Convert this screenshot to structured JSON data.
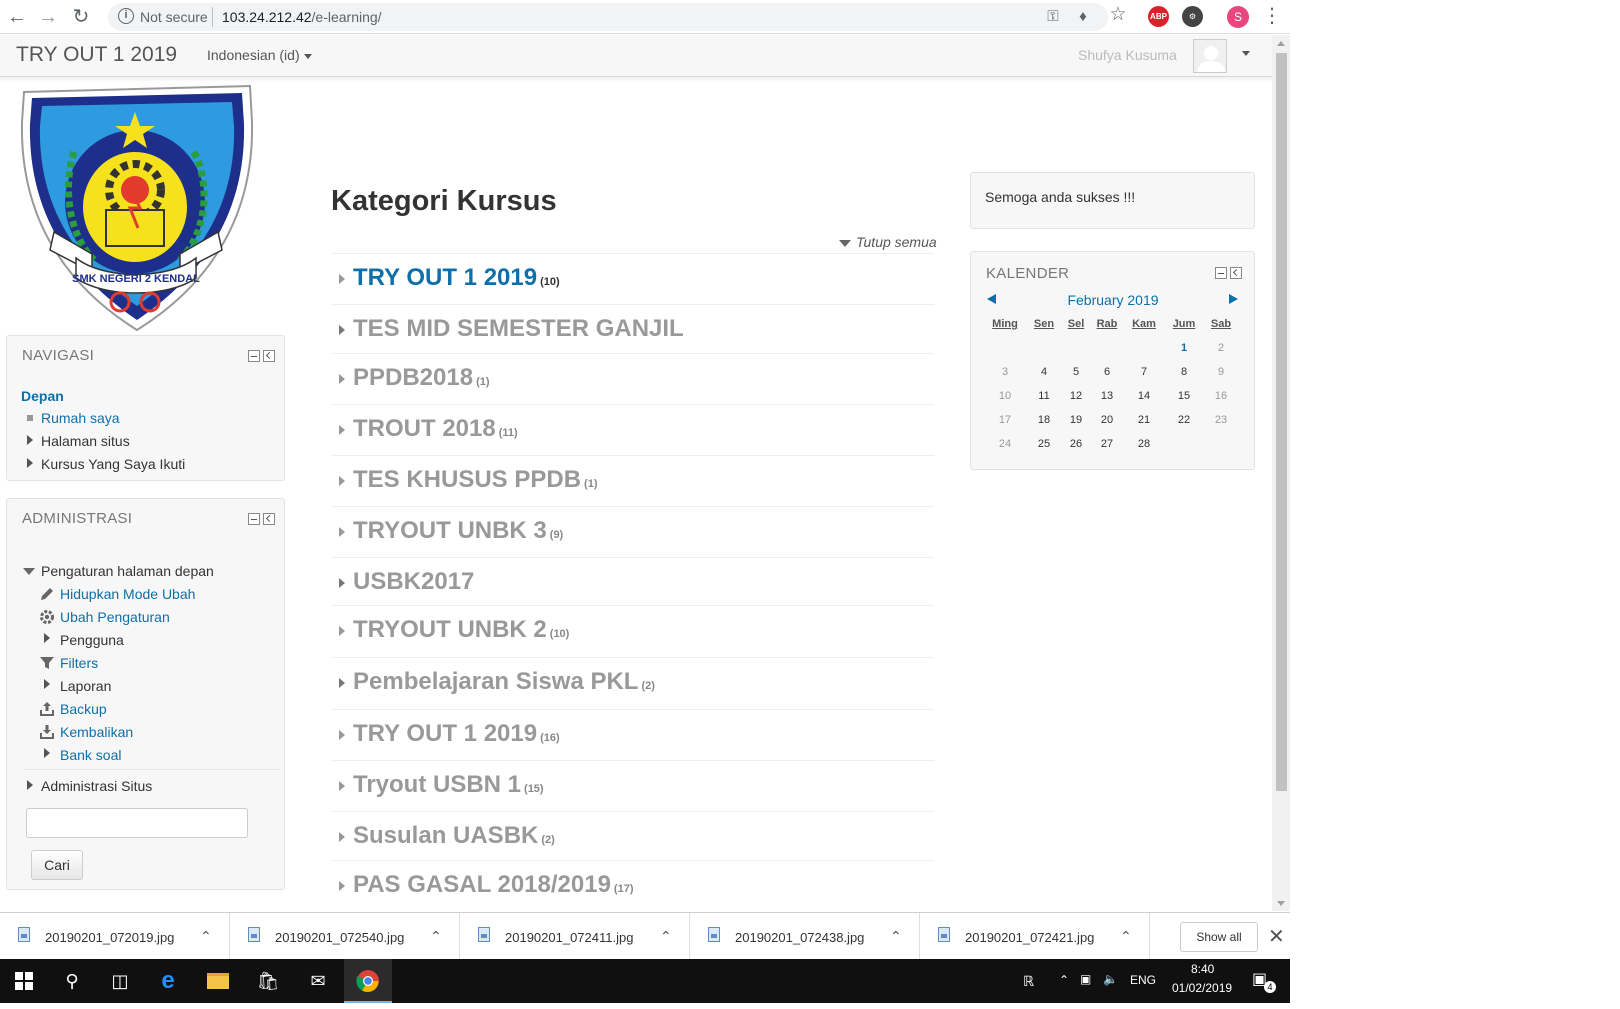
{
  "browser": {
    "security_label": "Not secure",
    "url_host": "103.24.212.42",
    "url_path": "/e-learning/",
    "profile_initial": "S",
    "ext_abp": "ABP"
  },
  "navbar": {
    "brand": "TRY OUT 1 2019",
    "language": "Indonesian (id)",
    "username": "Shufya Kusuma"
  },
  "logo": {
    "banner_text": "SMK NEGERI 2 KENDAL"
  },
  "navigasi": {
    "title": "NAVIGASI",
    "home": "Depan",
    "items": [
      "Rumah saya",
      "Halaman situs",
      "Kursus Yang Saya Ikuti"
    ]
  },
  "administrasi": {
    "title": "ADMINISTRASI",
    "section": "Pengaturan halaman depan",
    "items": [
      "Hidupkan Mode Ubah",
      "Ubah Pengaturan",
      "Pengguna",
      "Filters",
      "Laporan",
      "Backup",
      "Kembalikan",
      "Bank soal"
    ],
    "site_admin": "Administrasi Situs",
    "search_button": "Cari"
  },
  "main": {
    "title": "Kategori Kursus",
    "collapse_all": "Tutup semua",
    "categories": [
      {
        "name": "TRY OUT 1 2019",
        "count": "(10)"
      },
      {
        "name": "TES MID SEMESTER GANJIL",
        "count": ""
      },
      {
        "name": "PPDB2018",
        "count": "(1)"
      },
      {
        "name": "TROUT 2018",
        "count": "(11)"
      },
      {
        "name": "TES KHUSUS PPDB",
        "count": "(1)"
      },
      {
        "name": "TRYOUT UNBK 3",
        "count": "(9)"
      },
      {
        "name": "USBK2017",
        "count": ""
      },
      {
        "name": "TRYOUT UNBK 2",
        "count": "(10)"
      },
      {
        "name": "Pembelajaran Siswa PKL",
        "count": "(2)"
      },
      {
        "name": "TRY OUT 1 2019",
        "count": "(16)"
      },
      {
        "name": "Tryout USBN 1",
        "count": "(15)"
      },
      {
        "name": "Susulan UASBK",
        "count": "(2)"
      },
      {
        "name": "PAS GASAL 2018/2019",
        "count": "(17)"
      }
    ]
  },
  "message_block": {
    "text": "Semoga anda sukses !!!"
  },
  "calendar": {
    "title": "KALENDER",
    "month": "February 2019",
    "days": [
      "Ming",
      "Sen",
      "Sel",
      "Rab",
      "Kam",
      "Jum",
      "Sab"
    ],
    "weeks": [
      [
        "",
        "",
        "",
        "",
        "",
        "1",
        "2"
      ],
      [
        "3",
        "4",
        "5",
        "6",
        "7",
        "8",
        "9"
      ],
      [
        "10",
        "11",
        "12",
        "13",
        "14",
        "15",
        "16"
      ],
      [
        "17",
        "18",
        "19",
        "20",
        "21",
        "22",
        "23"
      ],
      [
        "24",
        "25",
        "26",
        "27",
        "28",
        "",
        ""
      ]
    ]
  },
  "downloads": {
    "files": [
      "20190201_072019.jpg",
      "20190201_072540.jpg",
      "20190201_072411.jpg",
      "20190201_072438.jpg",
      "20190201_072421.jpg"
    ],
    "show_all": "Show all"
  },
  "taskbar": {
    "language": "ENG",
    "time": "8:40",
    "date": "01/02/2019",
    "notification_count": "4"
  }
}
